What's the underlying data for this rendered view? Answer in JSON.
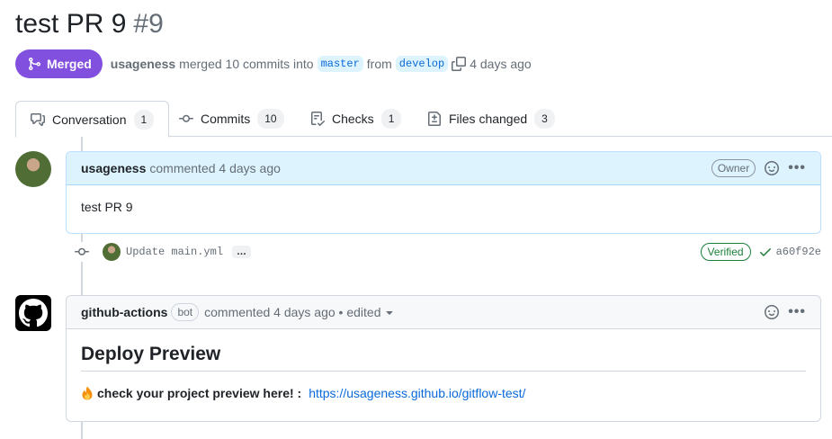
{
  "pr": {
    "title": "test PR 9",
    "number": "#9",
    "state_label": "Merged",
    "author": "usageness",
    "merge_text": "merged 10 commits into",
    "base_branch": "master",
    "from_text": "from",
    "head_branch": "develop",
    "time_ago": "4 days ago"
  },
  "tabs": [
    {
      "label": "Conversation",
      "count": "1",
      "icon": "comment-discussion-icon"
    },
    {
      "label": "Commits",
      "count": "10",
      "icon": "git-commit-icon"
    },
    {
      "label": "Checks",
      "count": "1",
      "icon": "checklist-icon"
    },
    {
      "label": "Files changed",
      "count": "3",
      "icon": "file-diff-icon"
    }
  ],
  "comments": [
    {
      "author": "usageness",
      "meta": "commented 4 days ago",
      "badge": "Owner",
      "body": "test PR 9"
    },
    {
      "author": "github-actions",
      "bot_label": "bot",
      "meta": "commented 4 days ago • edited",
      "heading": "Deploy Preview",
      "emoji": "fire-icon",
      "preview_text": "check your project preview here! :",
      "preview_link": "https://usageness.github.io/gitflow-test/"
    }
  ],
  "commit": {
    "message": "Update main.yml",
    "more": "…",
    "verified": "Verified",
    "sha": "a60f92e"
  },
  "colors": {
    "merged": "#8250df",
    "link": "#0969da",
    "owner_header": "#ddf4ff",
    "verified": "#1a7f37"
  }
}
